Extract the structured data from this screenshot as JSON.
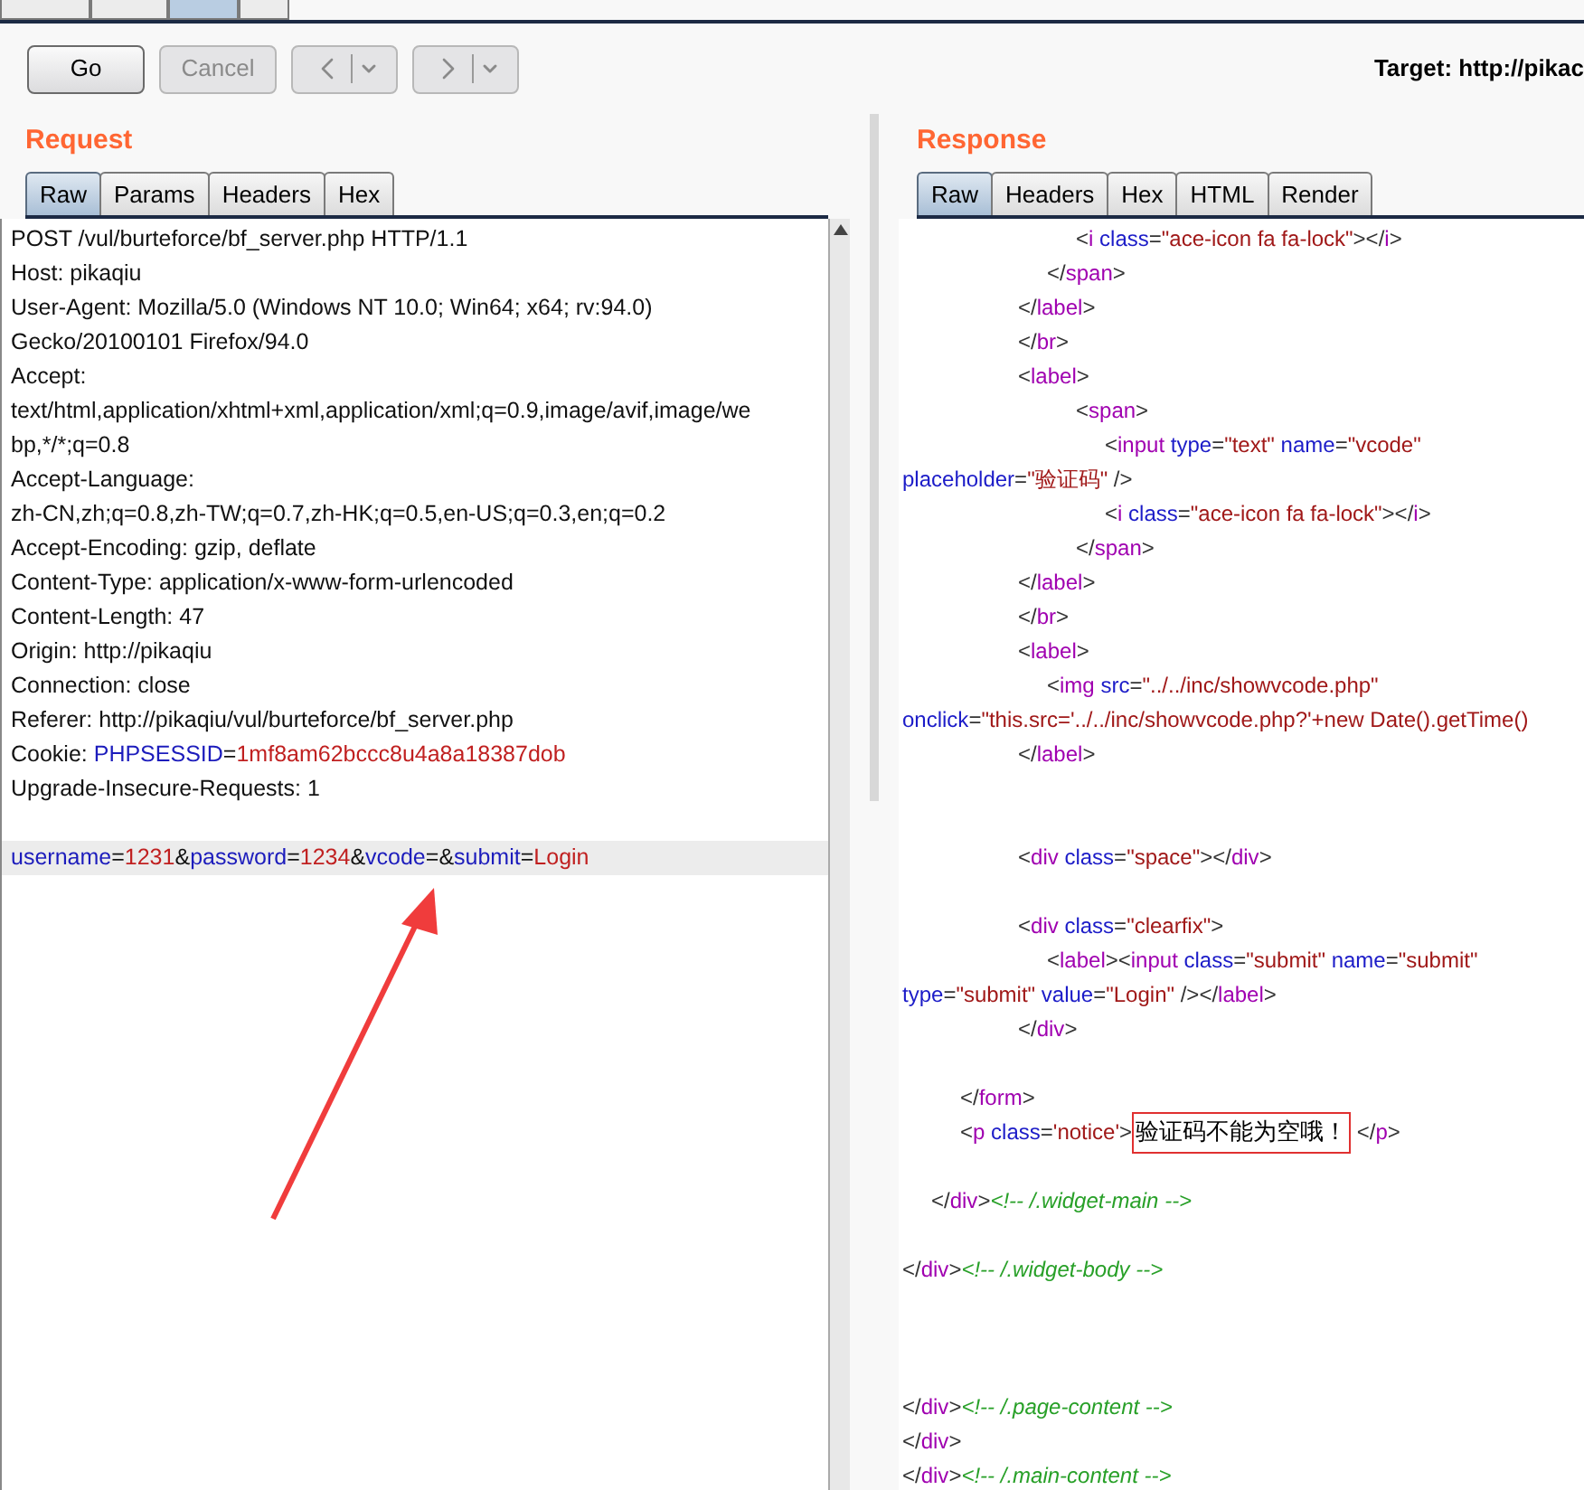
{
  "top_tabs": [
    {
      "selected": false
    },
    {
      "selected": false
    },
    {
      "selected": true
    },
    {
      "selected": false
    }
  ],
  "toolbar": {
    "buttons": [
      {
        "kind": "text",
        "label": "Go",
        "disabled": false
      },
      {
        "kind": "text",
        "label": "Cancel",
        "disabled": true
      },
      {
        "kind": "back",
        "disabled": true
      },
      {
        "kind": "forward",
        "disabled": true
      }
    ],
    "target": "Target: http://pikac"
  },
  "request": {
    "title": "Request",
    "tabs": [
      {
        "label": "Raw",
        "selected": true
      },
      {
        "label": "Params",
        "selected": false
      },
      {
        "label": "Headers",
        "selected": false
      },
      {
        "label": "Hex",
        "selected": false
      }
    ],
    "lines": [
      {
        "kind": "header",
        "parts": [
          {
            "kind": "plain",
            "text": "POST /vul/burteforce/bf_server.php HTTP/1.1"
          }
        ]
      },
      {
        "kind": "header",
        "parts": [
          {
            "kind": "plain",
            "text": "Host: pikaqiu"
          }
        ]
      },
      {
        "kind": "header",
        "parts": [
          {
            "kind": "plain",
            "text": "User-Agent: Mozilla/5.0 (Windows NT 10.0; Win64; x64; rv:94.0)"
          }
        ]
      },
      {
        "kind": "header",
        "parts": [
          {
            "kind": "plain",
            "text": "Gecko/20100101 Firefox/94.0"
          }
        ]
      },
      {
        "kind": "header",
        "parts": [
          {
            "kind": "plain",
            "text": "Accept:"
          }
        ]
      },
      {
        "kind": "header",
        "parts": [
          {
            "kind": "plain",
            "text": "text/html,application/xhtml+xml,application/xml;q=0.9,image/avif,image/we"
          }
        ]
      },
      {
        "kind": "header",
        "parts": [
          {
            "kind": "plain",
            "text": "bp,*/*;q=0.8"
          }
        ]
      },
      {
        "kind": "header",
        "parts": [
          {
            "kind": "plain",
            "text": "Accept-Language:"
          }
        ]
      },
      {
        "kind": "header",
        "parts": [
          {
            "kind": "plain",
            "text": "zh-CN,zh;q=0.8,zh-TW;q=0.7,zh-HK;q=0.5,en-US;q=0.3,en;q=0.2"
          }
        ]
      },
      {
        "kind": "header",
        "parts": [
          {
            "kind": "plain",
            "text": "Accept-Encoding: gzip, deflate"
          }
        ]
      },
      {
        "kind": "header",
        "parts": [
          {
            "kind": "plain",
            "text": "Content-Type: application/x-www-form-urlencoded"
          }
        ]
      },
      {
        "kind": "header",
        "parts": [
          {
            "kind": "plain",
            "text": "Content-Length: 47"
          }
        ]
      },
      {
        "kind": "header",
        "parts": [
          {
            "kind": "plain",
            "text": "Origin: http://pikaqiu"
          }
        ]
      },
      {
        "kind": "header",
        "parts": [
          {
            "kind": "plain",
            "text": "Connection: close"
          }
        ]
      },
      {
        "kind": "header",
        "parts": [
          {
            "kind": "plain",
            "text": "Referer: http://pikaqiu/vul/burteforce/bf_server.php"
          }
        ]
      },
      {
        "kind": "header",
        "parts": [
          {
            "kind": "plain",
            "text": "Cookie: "
          },
          {
            "kind": "param",
            "text": "PHPSESSID"
          },
          {
            "kind": "plain",
            "text": "="
          },
          {
            "kind": "value",
            "text": "1mf8am62bccc8u4a8a18387dob"
          }
        ]
      },
      {
        "kind": "header",
        "parts": [
          {
            "kind": "plain",
            "text": "Upgrade-Insecure-Requests: 1"
          }
        ]
      },
      {
        "kind": "blank"
      },
      {
        "kind": "body",
        "parts": [
          {
            "kind": "param",
            "text": "username"
          },
          {
            "kind": "plain",
            "text": "="
          },
          {
            "kind": "value",
            "text": "1231"
          },
          {
            "kind": "plain",
            "text": "&"
          },
          {
            "kind": "param",
            "text": "password"
          },
          {
            "kind": "plain",
            "text": "="
          },
          {
            "kind": "value",
            "text": "1234"
          },
          {
            "kind": "plain",
            "text": "&"
          },
          {
            "kind": "param",
            "text": "vcode"
          },
          {
            "kind": "plain",
            "text": "=&"
          },
          {
            "kind": "param",
            "text": "submit"
          },
          {
            "kind": "plain",
            "text": "="
          },
          {
            "kind": "value",
            "text": "Login"
          }
        ]
      }
    ]
  },
  "response": {
    "title": "Response",
    "tabs": [
      {
        "label": "Raw",
        "selected": true
      },
      {
        "label": "Headers",
        "selected": false
      },
      {
        "label": "Hex",
        "selected": false
      },
      {
        "label": "HTML",
        "selected": false
      },
      {
        "label": "Render",
        "selected": false
      }
    ],
    "lines": [
      {
        "kind": "code",
        "parts": [
          {
            "kind": "punct",
            "text": "\t\t\t\t\t\t<"
          },
          {
            "kind": "tag",
            "text": "i"
          },
          {
            "kind": "attr",
            "text": " class"
          },
          {
            "kind": "punct",
            "text": "="
          },
          {
            "kind": "string",
            "text": "\"ace-icon fa fa-lock\""
          },
          {
            "kind": "punct",
            "text": "></"
          },
          {
            "kind": "tag",
            "text": "i"
          },
          {
            "kind": "punct",
            "text": ">"
          }
        ]
      },
      {
        "kind": "code",
        "parts": [
          {
            "kind": "punct",
            "text": "\t\t\t\t\t</"
          },
          {
            "kind": "tag",
            "text": "span"
          },
          {
            "kind": "punct",
            "text": ">"
          }
        ]
      },
      {
        "kind": "code",
        "parts": [
          {
            "kind": "punct",
            "text": "\t\t\t\t</"
          },
          {
            "kind": "tag",
            "text": "label"
          },
          {
            "kind": "punct",
            "text": ">"
          }
        ]
      },
      {
        "kind": "code",
        "parts": [
          {
            "kind": "punct",
            "text": "\t\t\t\t</"
          },
          {
            "kind": "tag",
            "text": "br"
          },
          {
            "kind": "punct",
            "text": ">"
          }
        ]
      },
      {
        "kind": "code",
        "parts": [
          {
            "kind": "punct",
            "text": "\t\t\t\t<"
          },
          {
            "kind": "tag",
            "text": "label"
          },
          {
            "kind": "punct",
            "text": ">"
          }
        ]
      },
      {
        "kind": "code",
        "parts": [
          {
            "kind": "punct",
            "text": "\t\t\t\t\t\t<"
          },
          {
            "kind": "tag",
            "text": "span"
          },
          {
            "kind": "punct",
            "text": ">"
          }
        ]
      },
      {
        "kind": "code",
        "parts": [
          {
            "kind": "punct",
            "text": "\t\t\t\t\t\t\t<"
          },
          {
            "kind": "tag",
            "text": "input"
          },
          {
            "kind": "attr",
            "text": " type"
          },
          {
            "kind": "punct",
            "text": "="
          },
          {
            "kind": "string",
            "text": "\"text\""
          },
          {
            "kind": "attr",
            "text": " name"
          },
          {
            "kind": "punct",
            "text": "="
          },
          {
            "kind": "string",
            "text": "\"vcode\""
          }
        ]
      },
      {
        "kind": "code",
        "parts": [
          {
            "kind": "attr",
            "text": "placeholder"
          },
          {
            "kind": "punct",
            "text": "="
          },
          {
            "kind": "string",
            "text": "\"验证码\""
          },
          {
            "kind": "punct",
            "text": " />"
          }
        ]
      },
      {
        "kind": "code",
        "parts": [
          {
            "kind": "punct",
            "text": "\t\t\t\t\t\t\t<"
          },
          {
            "kind": "tag",
            "text": "i"
          },
          {
            "kind": "attr",
            "text": " class"
          },
          {
            "kind": "punct",
            "text": "="
          },
          {
            "kind": "string",
            "text": "\"ace-icon fa fa-lock\""
          },
          {
            "kind": "punct",
            "text": "></"
          },
          {
            "kind": "tag",
            "text": "i"
          },
          {
            "kind": "punct",
            "text": ">"
          }
        ]
      },
      {
        "kind": "code",
        "parts": [
          {
            "kind": "punct",
            "text": "\t\t\t\t\t\t</"
          },
          {
            "kind": "tag",
            "text": "span"
          },
          {
            "kind": "punct",
            "text": ">"
          }
        ]
      },
      {
        "kind": "code",
        "parts": [
          {
            "kind": "punct",
            "text": "\t\t\t\t</"
          },
          {
            "kind": "tag",
            "text": "label"
          },
          {
            "kind": "punct",
            "text": ">"
          }
        ]
      },
      {
        "kind": "code",
        "parts": [
          {
            "kind": "punct",
            "text": "\t\t\t\t</"
          },
          {
            "kind": "tag",
            "text": "br"
          },
          {
            "kind": "punct",
            "text": ">"
          }
        ]
      },
      {
        "kind": "code",
        "parts": [
          {
            "kind": "punct",
            "text": "\t\t\t\t<"
          },
          {
            "kind": "tag",
            "text": "label"
          },
          {
            "kind": "punct",
            "text": ">"
          }
        ]
      },
      {
        "kind": "code",
        "parts": [
          {
            "kind": "punct",
            "text": "\t\t\t\t\t<"
          },
          {
            "kind": "tag",
            "text": "img"
          },
          {
            "kind": "attr",
            "text": " src"
          },
          {
            "kind": "punct",
            "text": "="
          },
          {
            "kind": "string",
            "text": "\"../../inc/showvcode.php\""
          }
        ]
      },
      {
        "kind": "code",
        "parts": [
          {
            "kind": "attr",
            "text": "onclick"
          },
          {
            "kind": "punct",
            "text": "="
          },
          {
            "kind": "string",
            "text": "\"this.src='../../inc/showvcode.php?'+new Date().getTime()"
          }
        ]
      },
      {
        "kind": "code",
        "parts": [
          {
            "kind": "punct",
            "text": "\t\t\t\t</"
          },
          {
            "kind": "tag",
            "text": "label"
          },
          {
            "kind": "punct",
            "text": ">"
          }
        ]
      },
      {
        "kind": "blank"
      },
      {
        "kind": "blank"
      },
      {
        "kind": "code",
        "parts": [
          {
            "kind": "punct",
            "text": "\t\t\t\t<"
          },
          {
            "kind": "tag",
            "text": "div"
          },
          {
            "kind": "attr",
            "text": " class"
          },
          {
            "kind": "punct",
            "text": "="
          },
          {
            "kind": "string",
            "text": "\"space\""
          },
          {
            "kind": "punct",
            "text": "></"
          },
          {
            "kind": "tag",
            "text": "div"
          },
          {
            "kind": "punct",
            "text": ">"
          }
        ]
      },
      {
        "kind": "blank"
      },
      {
        "kind": "code",
        "parts": [
          {
            "kind": "punct",
            "text": "\t\t\t\t<"
          },
          {
            "kind": "tag",
            "text": "div"
          },
          {
            "kind": "attr",
            "text": " class"
          },
          {
            "kind": "punct",
            "text": "="
          },
          {
            "kind": "string",
            "text": "\"clearfix\""
          },
          {
            "kind": "punct",
            "text": ">"
          }
        ]
      },
      {
        "kind": "code",
        "parts": [
          {
            "kind": "punct",
            "text": "\t\t\t\t\t<"
          },
          {
            "kind": "tag",
            "text": "label"
          },
          {
            "kind": "punct",
            "text": "><"
          },
          {
            "kind": "tag",
            "text": "input"
          },
          {
            "kind": "attr",
            "text": " class"
          },
          {
            "kind": "punct",
            "text": "="
          },
          {
            "kind": "string",
            "text": "\"submit\""
          },
          {
            "kind": "attr",
            "text": " name"
          },
          {
            "kind": "punct",
            "text": "="
          },
          {
            "kind": "string",
            "text": "\"submit\""
          }
        ]
      },
      {
        "kind": "code",
        "parts": [
          {
            "kind": "attr",
            "text": "type"
          },
          {
            "kind": "punct",
            "text": "="
          },
          {
            "kind": "string",
            "text": "\"submit\""
          },
          {
            "kind": "attr",
            "text": " value"
          },
          {
            "kind": "punct",
            "text": "="
          },
          {
            "kind": "string",
            "text": "\"Login\""
          },
          {
            "kind": "punct",
            "text": " /></"
          },
          {
            "kind": "tag",
            "text": "label"
          },
          {
            "kind": "punct",
            "text": ">"
          }
        ]
      },
      {
        "kind": "code",
        "parts": [
          {
            "kind": "punct",
            "text": "\t\t\t\t</"
          },
          {
            "kind": "tag",
            "text": "div"
          },
          {
            "kind": "punct",
            "text": ">"
          }
        ]
      },
      {
        "kind": "blank"
      },
      {
        "kind": "code",
        "parts": [
          {
            "kind": "punct",
            "text": "\t\t</"
          },
          {
            "kind": "tag",
            "text": "form"
          },
          {
            "kind": "punct",
            "text": ">"
          }
        ]
      },
      {
        "kind": "code",
        "parts": [
          {
            "kind": "punct",
            "text": "\t\t<"
          },
          {
            "kind": "tag",
            "text": "p"
          },
          {
            "kind": "attr",
            "text": " class"
          },
          {
            "kind": "punct",
            "text": "="
          },
          {
            "kind": "string",
            "text": "'notice'"
          },
          {
            "kind": "punct",
            "text": ">"
          },
          {
            "kind": "boxed",
            "text": "验证码不能为空哦！"
          },
          {
            "kind": "punct",
            "text": " </"
          },
          {
            "kind": "tag",
            "text": "p"
          },
          {
            "kind": "punct",
            "text": ">"
          }
        ]
      },
      {
        "kind": "blank"
      },
      {
        "kind": "code",
        "parts": [
          {
            "kind": "punct",
            "text": "\t</"
          },
          {
            "kind": "tag",
            "text": "div"
          },
          {
            "kind": "punct",
            "text": ">"
          },
          {
            "kind": "comment",
            "text": "<!-- /.widget-main -->"
          }
        ]
      },
      {
        "kind": "blank"
      },
      {
        "kind": "code",
        "parts": [
          {
            "kind": "punct",
            "text": "</"
          },
          {
            "kind": "tag",
            "text": "div"
          },
          {
            "kind": "punct",
            "text": ">"
          },
          {
            "kind": "comment",
            "text": "<!-- /.widget-body -->"
          }
        ]
      },
      {
        "kind": "blank"
      },
      {
        "kind": "blank"
      },
      {
        "kind": "blank"
      },
      {
        "kind": "code",
        "parts": [
          {
            "kind": "punct",
            "text": "</"
          },
          {
            "kind": "tag",
            "text": "div"
          },
          {
            "kind": "punct",
            "text": ">"
          },
          {
            "kind": "comment",
            "text": "<!-- /.page-content -->"
          }
        ]
      },
      {
        "kind": "code",
        "parts": [
          {
            "kind": "punct",
            "text": "</"
          },
          {
            "kind": "tag",
            "text": "div"
          },
          {
            "kind": "punct",
            "text": ">"
          }
        ]
      },
      {
        "kind": "code",
        "parts": [
          {
            "kind": "punct",
            "text": "</"
          },
          {
            "kind": "tag",
            "text": "div"
          },
          {
            "kind": "punct",
            "text": ">"
          },
          {
            "kind": "comment",
            "text": "<!-- /.main-content -->"
          }
        ]
      }
    ]
  }
}
